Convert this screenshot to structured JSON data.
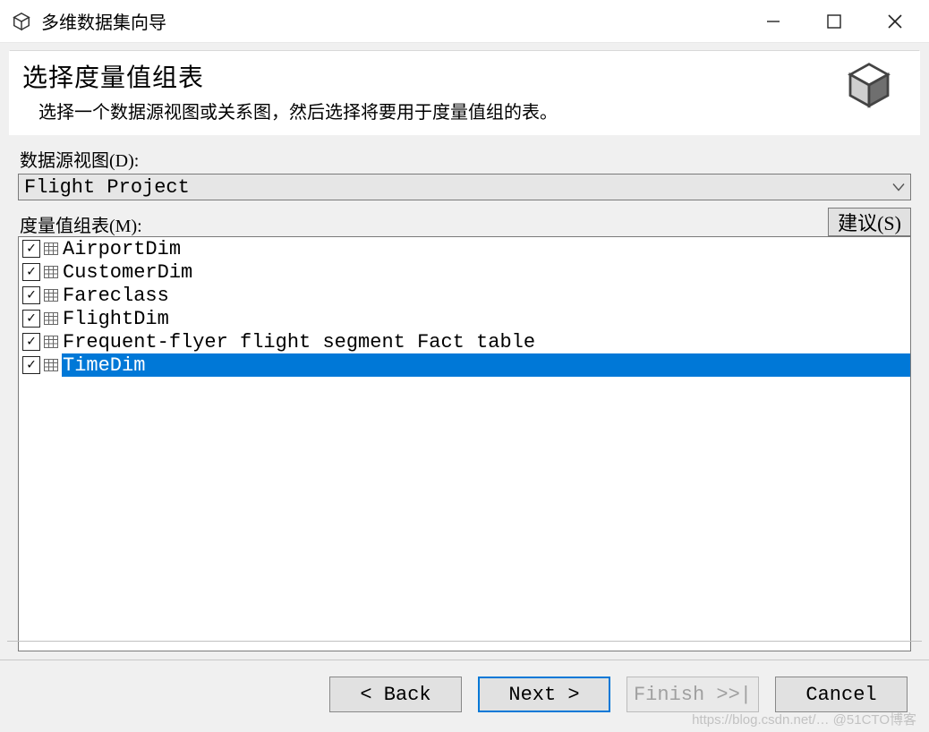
{
  "window": {
    "title": "多维数据集向导"
  },
  "header": {
    "heading": "选择度量值组表",
    "sub": "选择一个数据源视图或关系图，然后选择将要用于度量值组的表。"
  },
  "dsv": {
    "label": "数据源视图(D):",
    "value": "Flight Project"
  },
  "measure": {
    "label": "度量值组表(M):",
    "suggest": "建议(S)",
    "items": [
      {
        "checked": true,
        "name": "AirportDim",
        "selected": false
      },
      {
        "checked": true,
        "name": "CustomerDim",
        "selected": false
      },
      {
        "checked": true,
        "name": "Fareclass",
        "selected": false
      },
      {
        "checked": true,
        "name": "FlightDim",
        "selected": false
      },
      {
        "checked": true,
        "name": "Frequent-flyer flight segment Fact table",
        "selected": false
      },
      {
        "checked": true,
        "name": "TimeDim",
        "selected": true
      }
    ]
  },
  "nav": {
    "back": "< Back",
    "next": "Next >",
    "finish": "Finish >>|",
    "cancel": "Cancel"
  },
  "watermark": "https://blog.csdn.net/…  @51CTO博客"
}
